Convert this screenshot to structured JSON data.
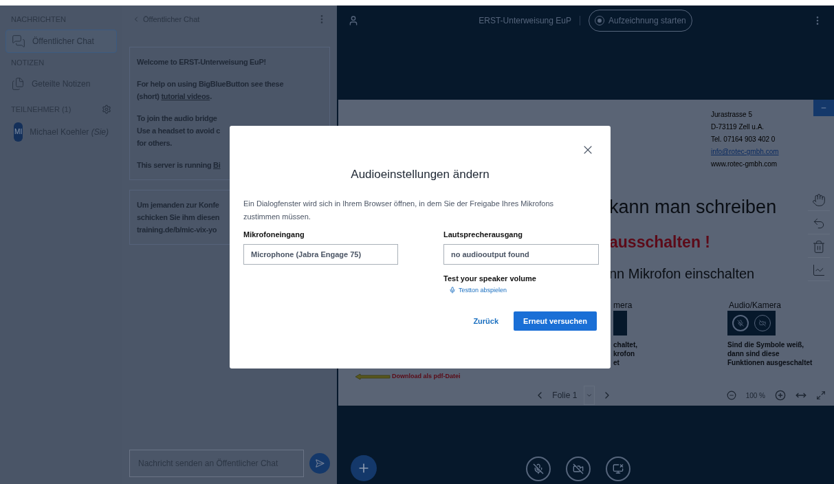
{
  "sidebar": {
    "sections": [
      {
        "title": "NACHRICHTEN",
        "items": [
          {
            "label": "Öffentlicher Chat",
            "kind": "chat",
            "selected": true
          }
        ]
      },
      {
        "title": "NOTIZEN",
        "items": [
          {
            "label": "Geteilte Notizen",
            "kind": "notes",
            "selected": false
          }
        ]
      }
    ],
    "participants": {
      "title": "TEILNEHMER (1)",
      "users": [
        {
          "initials": "MI",
          "name": "Michael Koehler",
          "suffix": "(Sie)"
        }
      ]
    }
  },
  "chat": {
    "title": "Öffentlicher Chat",
    "messages": [
      {
        "paragraphs": [
          [
            [
              {
                "text": "Welcome to ERST-Unterweisung EuP!",
                "link": false
              }
            ]
          ],
          [
            [
              {
                "text": "For help on using BigBlueButton see these",
                "link": false
              }
            ],
            [
              {
                "text": "(short) ",
                "link": false
              },
              {
                "text": "tutorial videos",
                "link": true
              },
              {
                "text": ".",
                "link": false
              }
            ]
          ],
          [
            [
              {
                "text": "To join the audio bridge",
                "link": false
              }
            ],
            [
              {
                "text": "Use a headset to avoid c",
                "link": false
              }
            ],
            [
              {
                "text": "for others.",
                "link": false
              }
            ]
          ],
          [
            [
              {
                "text": "This server is running ",
                "link": false
              },
              {
                "text": "Bi",
                "link": true
              }
            ]
          ]
        ]
      },
      {
        "paragraphs": [
          [
            [
              {
                "text": "Um jemanden zur Konfe",
                "link": false
              }
            ],
            [
              {
                "text": "schicken Sie ihm diesen",
                "link": false
              }
            ],
            [
              {
                "text": "training.de/b/mic-vix-yo",
                "link": false
              }
            ]
          ]
        ]
      }
    ],
    "input": {
      "placeholder": "Nachricht senden an Öffentlicher Chat"
    }
  },
  "topbar": {
    "title": "ERST-Unterweisung EuP",
    "record_button": "Aufzeichnung starten"
  },
  "slide": {
    "address": [
      {
        "text": "Jurastrasse 5",
        "link": false
      },
      {
        "text": "D-73119 Zell u.A.",
        "link": false
      },
      {
        "text": "Tel. 07164 903 402 0",
        "link": false
      },
      {
        "text": "info@rotec-gmbh.com",
        "link": true
      },
      {
        "text": "www.rotec-gmbh.com",
        "link": false
      }
    ],
    "line_1": "kann man schreiben",
    "line_2": "ausschalten !",
    "line_3": "nn Mikrofon einschalten",
    "left_heading": "mera",
    "right_heading": "Audio/Kamera",
    "left_caption": [
      "chaltet,",
      "krofon",
      "et"
    ],
    "right_caption": [
      "Sind die Symbole weiß,",
      "dann sind diese",
      "Funktionen ausgeschaltet"
    ],
    "download": "Download als pdf-Datei"
  },
  "slide_nav": {
    "slide": "Folie 1",
    "zoom": "100 %"
  },
  "dialog": {
    "title": "Audioeinstellungen ändern",
    "description": "Ein Dialogfenster wird sich in Ihrem Browser öffnen, in dem Sie der Freigabe Ihres Mikrofons zustimmen müssen.",
    "mic_label": "Mikrofoneingang",
    "mic_value": "Microphone (Jabra Engage 75)",
    "speaker_label": "Lautsprecherausgang",
    "speaker_value": "no audiooutput found",
    "test_label": "Test your speaker volume",
    "test_link": "Testton abspielen",
    "back_button": "Zurück",
    "retry_button": "Erneut versuchen"
  }
}
